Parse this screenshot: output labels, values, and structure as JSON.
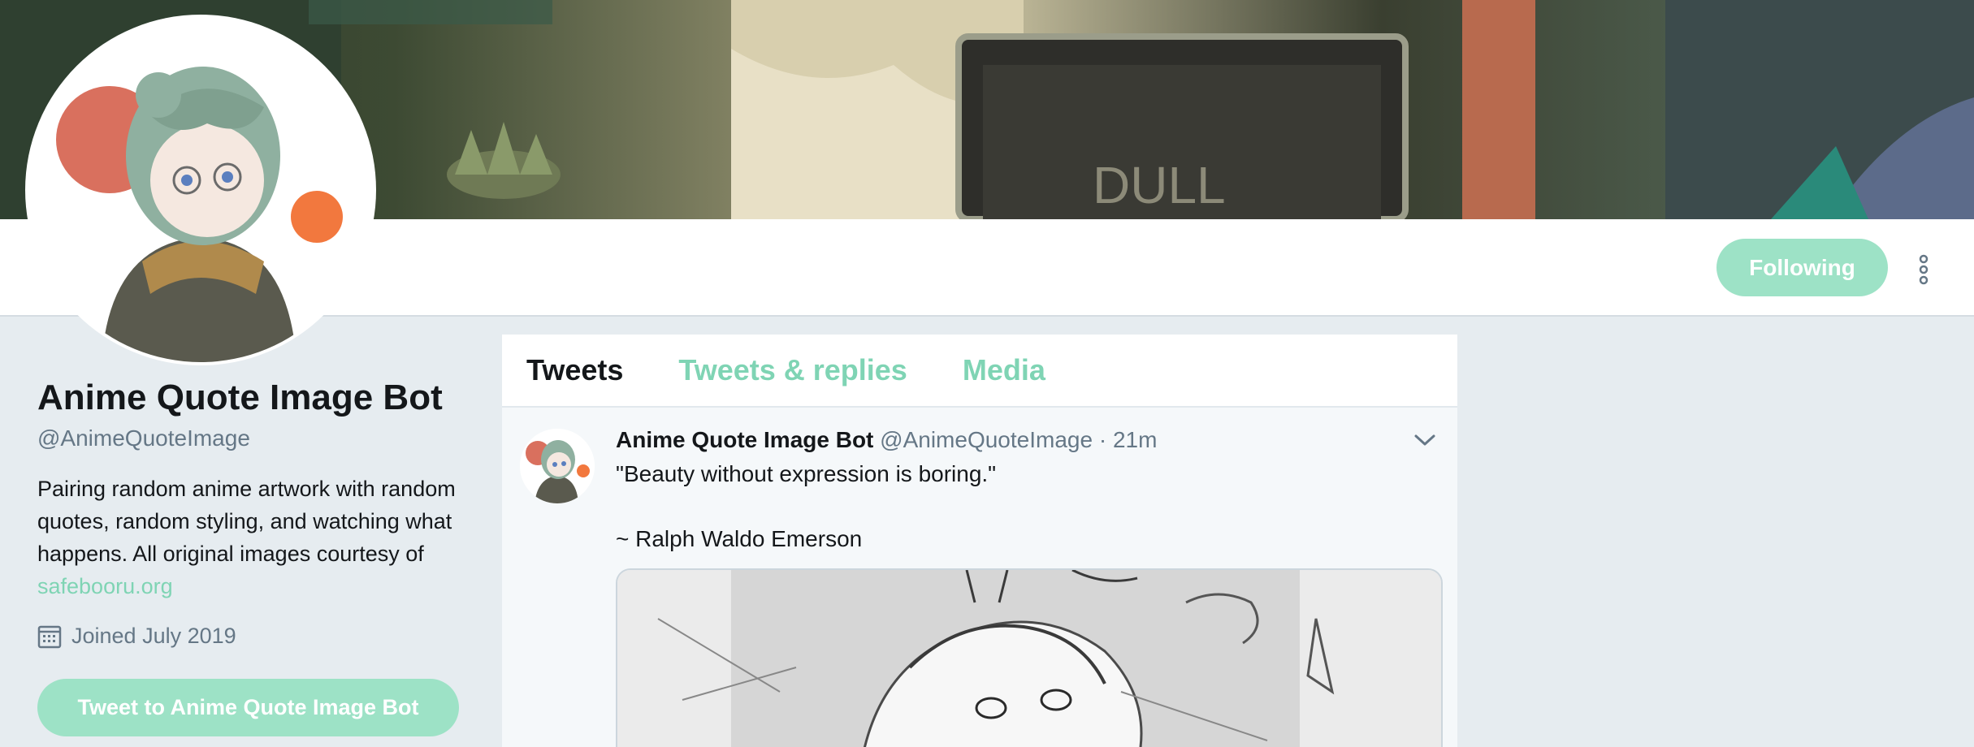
{
  "banner": {
    "sign_text": "DULL"
  },
  "profile": {
    "name": "Anime Quote Image Bot",
    "handle": "@AnimeQuoteImage",
    "bio_text": "Pairing random anime artwork with random quotes, random styling, and watching what happens. All original images courtesy of ",
    "bio_link": "safebooru.org",
    "joined": "Joined July 2019",
    "following_label": "Following",
    "tweet_to_label": "Tweet to Anime Quote Image Bot"
  },
  "tabs": [
    {
      "label": "Tweets",
      "active": true
    },
    {
      "label": "Tweets & replies",
      "active": false
    },
    {
      "label": "Media",
      "active": false
    }
  ],
  "tweet": {
    "author": "Anime Quote Image Bot",
    "handle": "@AnimeQuoteImage",
    "time": "21m",
    "separator": "·",
    "text": "\"Beauty without expression is boring.\"\n\n~ Ralph Waldo Emerson"
  },
  "colors": {
    "accent": "#7fd4b4",
    "button": "#9de2c6",
    "background": "#e6ecf0",
    "secondary_text": "#657786"
  },
  "icons": {
    "more": "more-vertical-icon",
    "calendar": "calendar-icon",
    "caret": "chevron-down-icon"
  }
}
